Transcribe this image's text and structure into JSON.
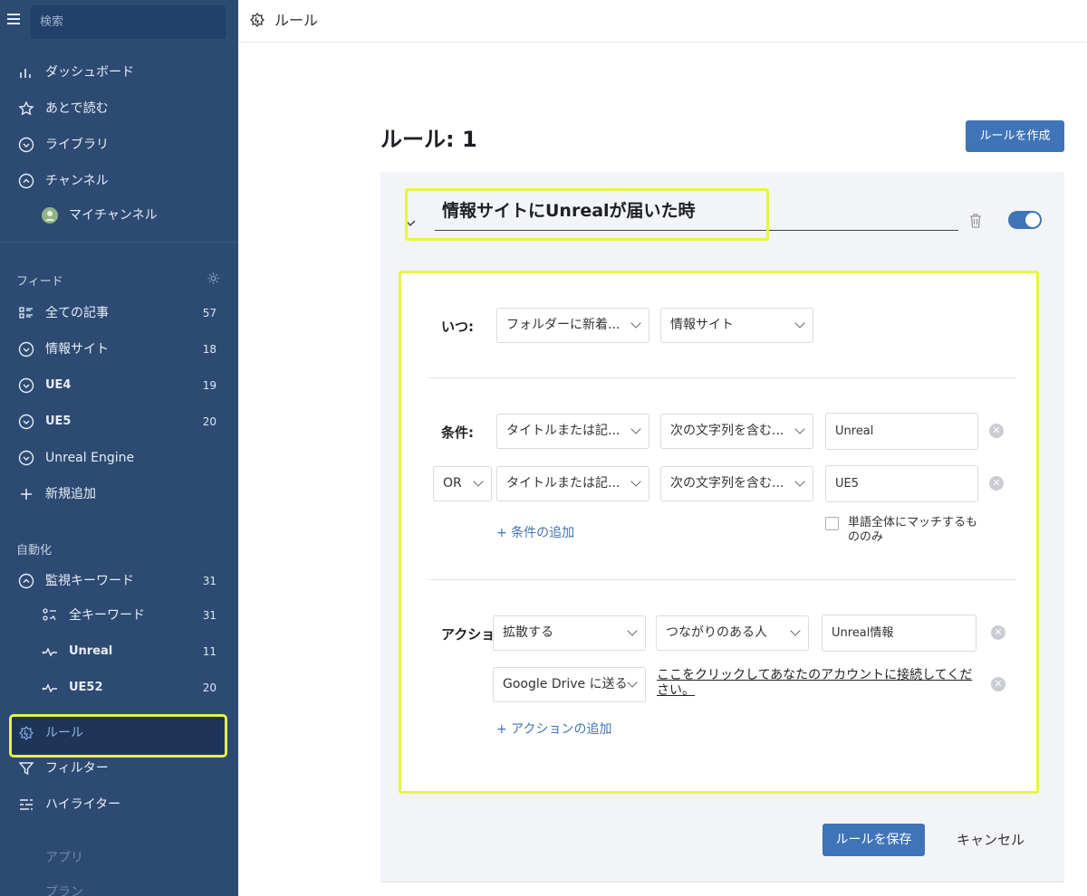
{
  "sidebar": {
    "search_placeholder": "検索",
    "main_items": [
      {
        "label": "ダッシュボード",
        "icon": "bar-chart-icon"
      },
      {
        "label": "あとで読む",
        "icon": "star-icon"
      },
      {
        "label": "ライブラリ",
        "icon": "chevron-circle-down-icon"
      },
      {
        "label": "チャンネル",
        "icon": "chevron-circle-up-icon"
      },
      {
        "label": "マイチャンネル",
        "icon": "avatar"
      }
    ],
    "feed_section": "フィード",
    "feeds": [
      {
        "label": "全ての記事",
        "count": "57",
        "icon": "list-icon"
      },
      {
        "label": "情報サイト",
        "count": "18",
        "icon": "chevron-circle-down-icon"
      },
      {
        "label": "UE4",
        "count": "19",
        "icon": "chevron-circle-down-icon"
      },
      {
        "label": "UE5",
        "count": "20",
        "icon": "chevron-circle-down-icon"
      },
      {
        "label": "Unreal Engine",
        "count": "",
        "icon": "chevron-circle-down-icon"
      },
      {
        "label": "新規追加",
        "count": "",
        "icon": "plus-icon"
      }
    ],
    "automation_section": "自動化",
    "automation": [
      {
        "label": "監視キーワード",
        "count": "31",
        "icon": "chevron-circle-up-icon"
      },
      {
        "label": "全キーワード",
        "count": "31",
        "icon": "keywords-icon"
      },
      {
        "label": "Unreal",
        "count": "11",
        "icon": "pulse-icon"
      },
      {
        "label": "UE52",
        "count": "20",
        "icon": "pulse-icon"
      },
      {
        "label": "ルール",
        "count": "",
        "icon": "rules-icon"
      },
      {
        "label": "フィルター",
        "count": "",
        "icon": "filter-icon"
      },
      {
        "label": "ハイライター",
        "count": "",
        "icon": "highlighter-icon"
      }
    ],
    "apps": "アプリ",
    "plan": "プラン"
  },
  "header": {
    "title": "ルール"
  },
  "main": {
    "page_title": "ルール: 1",
    "create_button": "ルールを作成",
    "rule_name": "情報サイトにUnrealが届いた時",
    "when_label": "いつ:",
    "when_trigger": "フォルダーに新着...",
    "when_folder": "情報サイト",
    "conditions_label": "条件:",
    "conditions": [
      {
        "op": "",
        "field": "タイトルまたは記...",
        "match": "次の文字列を含む...",
        "value": "Unreal"
      },
      {
        "op": "OR",
        "field": "タイトルまたは記...",
        "match": "次の文字列を含む...",
        "value": "UE5"
      }
    ],
    "add_condition": "+ 条件の追加",
    "whole_word": "単語全体にマッチするもののみ",
    "actions_label": "アクション",
    "actions": [
      {
        "action": "拡散する",
        "target": "つながりのある人",
        "value": "Unreal情報"
      },
      {
        "action": "Google Drive に送る",
        "link": "ここをクリックしてあなたのアカウントに接続してください。"
      }
    ],
    "add_action": "+ アクションの追加",
    "save_button": "ルールを保存",
    "cancel_button": "キャンセル"
  }
}
